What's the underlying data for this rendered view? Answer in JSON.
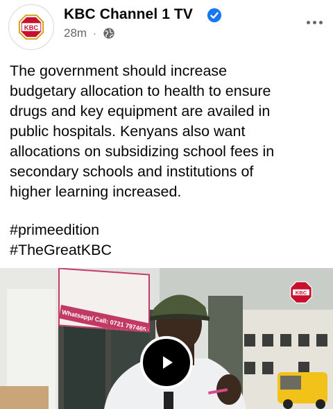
{
  "post": {
    "page_name": "KBC Channel 1 TV",
    "time": "28m",
    "separator": "·",
    "logo_text": "KBC",
    "text": "The government should increase\nbudgetary allocation to health to ensure\ndrugs and key equipment are availed in\npublic hospitals. Kenyans also want\nallocations on subsidizing school fees in\nsecondary schools and institutions of\nhigher learning increased.",
    "hashtags": [
      "#primeedition",
      "#TheGreatKBC"
    ]
  },
  "video": {
    "sign_text": "Whatsapp/ Call: 0721 797465",
    "watermark_text": "KBC"
  },
  "icons": {
    "verified": "verified-badge-icon",
    "audience": "globe-icon",
    "more": "more-options-icon",
    "play": "play-icon"
  },
  "colors": {
    "verified_blue": "#1877f2",
    "meta_gray": "#65676b",
    "kbc_red": "#c8102e",
    "kbc_gold": "#d4a017"
  }
}
